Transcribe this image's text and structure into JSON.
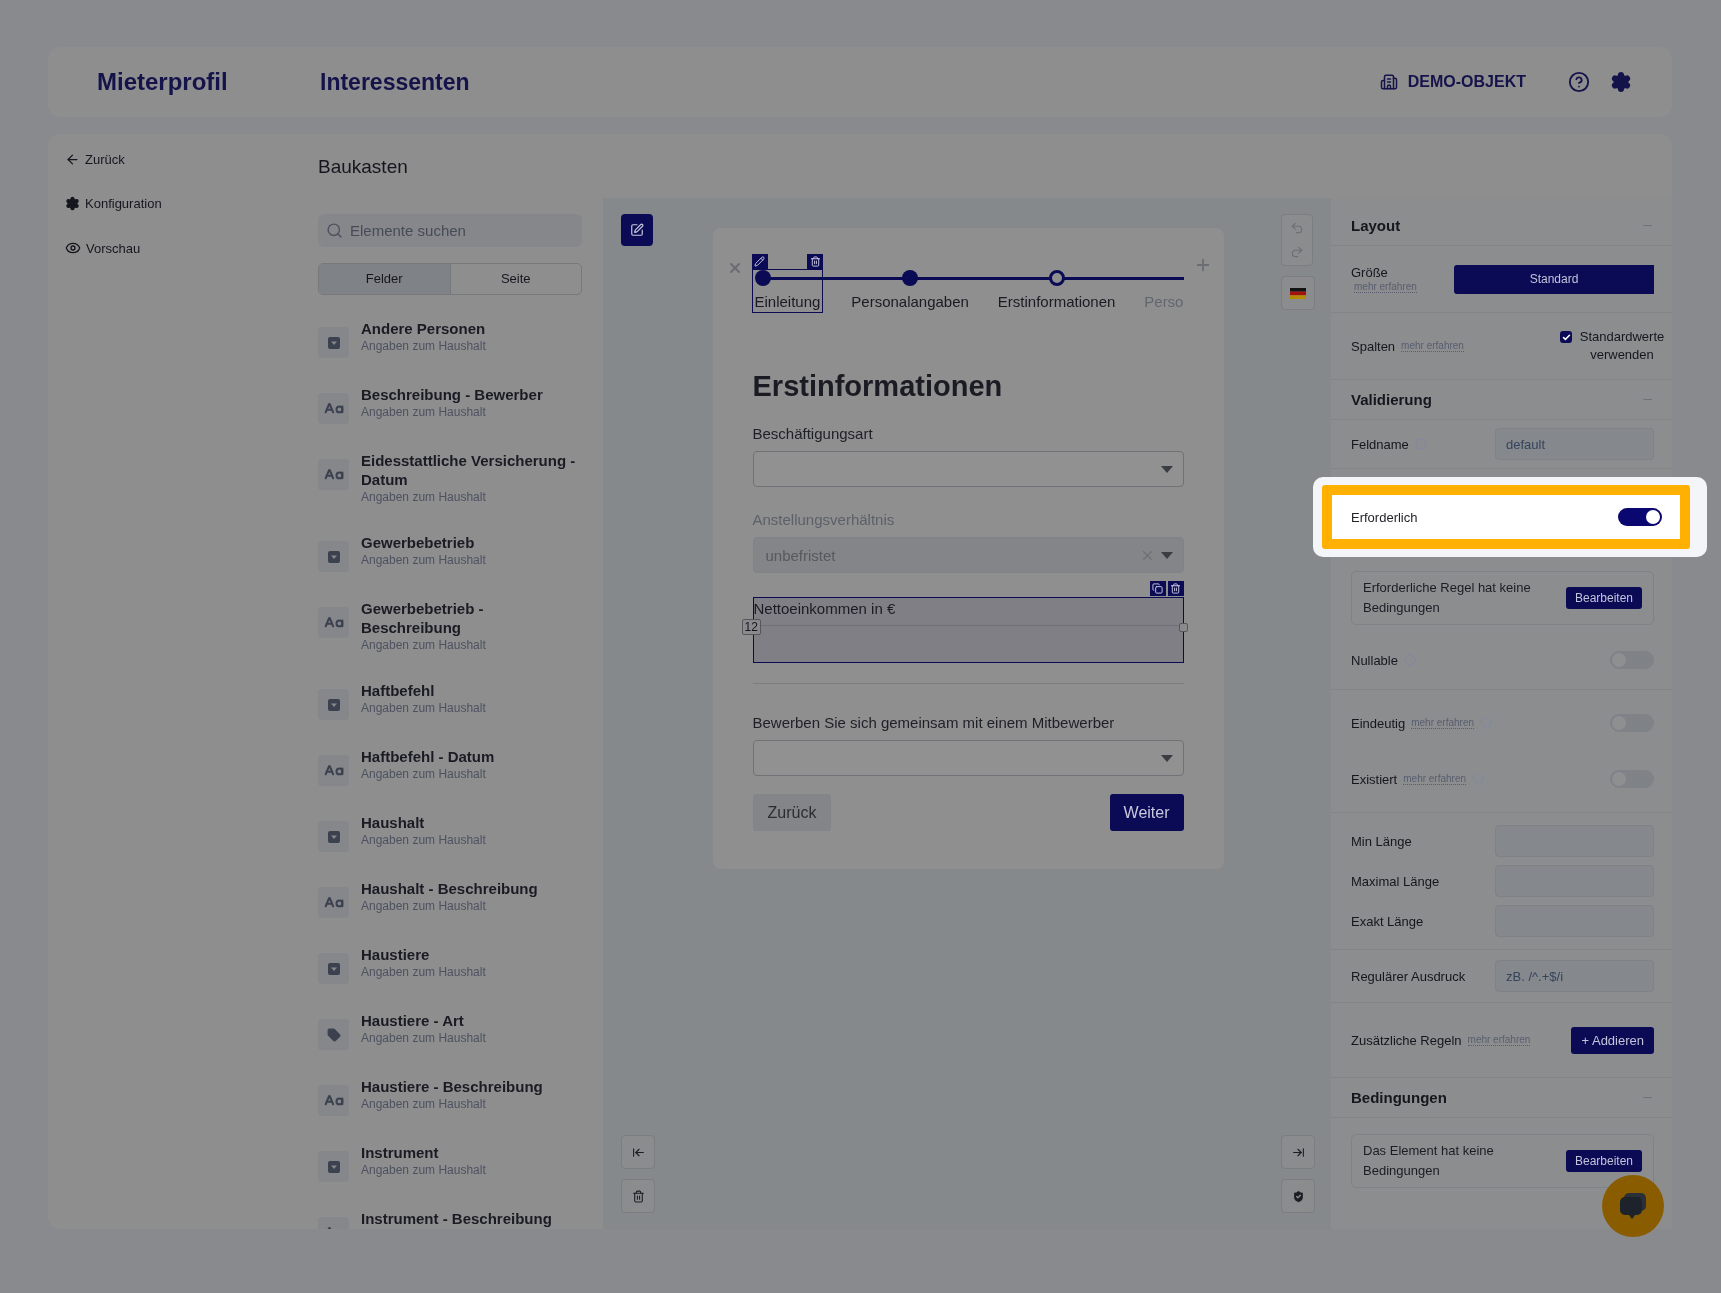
{
  "header": {
    "brand": "Mieterprofil",
    "section": "Interessenten",
    "object": "DEMO-OBJEKT"
  },
  "nav": [
    {
      "label": "Zurück",
      "kind": "back"
    },
    {
      "label": "Konfiguration",
      "kind": "settings"
    },
    {
      "label": "Vorschau",
      "kind": "preview"
    }
  ],
  "builder": {
    "title": "Baukasten",
    "search": {
      "placeholder": "Elemente suchen"
    },
    "tabs": [
      {
        "label": "Felder",
        "selected": true
      },
      {
        "label": "Seite",
        "selected": false
      }
    ],
    "items": [
      {
        "title": "Andere Personen",
        "subtitle": "Angaben zum Haushalt",
        "kind": "select"
      },
      {
        "title": "Beschreibung - Bewerber",
        "subtitle": "Angaben zum Haushalt",
        "kind": "text"
      },
      {
        "title": "Eidesstattliche Versicherung - Datum",
        "subtitle": "Angaben zum Haushalt",
        "kind": "text"
      },
      {
        "title": "Gewerbebetrieb",
        "subtitle": "Angaben zum Haushalt",
        "kind": "select"
      },
      {
        "title": "Gewerbebetrieb - Beschreibung",
        "subtitle": "Angaben zum Haushalt",
        "kind": "text"
      },
      {
        "title": "Haftbefehl",
        "subtitle": "Angaben zum Haushalt",
        "kind": "select"
      },
      {
        "title": "Haftbefehl - Datum",
        "subtitle": "Angaben zum Haushalt",
        "kind": "text"
      },
      {
        "title": "Haushalt",
        "subtitle": "Angaben zum Haushalt",
        "kind": "select"
      },
      {
        "title": "Haushalt - Beschreibung",
        "subtitle": "Angaben zum Haushalt",
        "kind": "text"
      },
      {
        "title": "Haustiere",
        "subtitle": "Angaben zum Haushalt",
        "kind": "select"
      },
      {
        "title": "Haustiere - Art",
        "subtitle": "Angaben zum Haushalt",
        "kind": "tag"
      },
      {
        "title": "Haustiere - Beschreibung",
        "subtitle": "Angaben zum Haushalt",
        "kind": "text"
      },
      {
        "title": "Instrument",
        "subtitle": "Angaben zum Haushalt",
        "kind": "select"
      },
      {
        "title": "Instrument - Beschreibung",
        "kind": "text"
      }
    ]
  },
  "canvas": {
    "steps": [
      {
        "label": "Einleitung",
        "completed": true,
        "selected": false,
        "editing": true
      },
      {
        "label": "Personalangaben",
        "completed": true,
        "selected": false,
        "editing": false
      },
      {
        "label": "Erstinformationen",
        "completed": false,
        "selected": true,
        "editing": false
      },
      {
        "label": "Perso",
        "completed": false,
        "selected": false,
        "editing": false
      }
    ],
    "form": {
      "heading": "Erstinformationen",
      "fields": [
        {
          "kind": "select",
          "label": "Beschäftigungsart",
          "disabled": false
        },
        {
          "kind": "select",
          "label": "Anstellungsverhältnis",
          "value": "unbefristet",
          "disabled": true
        },
        {
          "kind": "textarea",
          "label": "Nettoeinkommen in €",
          "badge": "12",
          "selected": true
        },
        {
          "kind": "divider"
        },
        {
          "kind": "select",
          "label": "Bewerben Sie sich gemeinsam mit einem Mitbewerber",
          "disabled": false
        }
      ],
      "back": "Zurück",
      "next": "Weiter"
    }
  },
  "panel": {
    "layout": {
      "title": "Layout",
      "size": {
        "label": "Größe",
        "link": "mehr erfahren",
        "value": "Standard"
      },
      "columns": {
        "label": "Spalten",
        "link": "mehr erfahren",
        "checkbox": {
          "label": "Standardwerte verwenden",
          "checked": true
        }
      }
    },
    "validation": {
      "title": "Validierung",
      "groups": [
        [
          {
            "kind": "input",
            "label": "Feldname",
            "info": true,
            "placeholder": "default"
          }
        ],
        [
          {
            "kind": "toggle",
            "label": "Erforderlich",
            "on": true,
            "highlighted": true
          },
          {
            "kind": "note",
            "text": "Erforderliche Regel hat keine Bedingungen",
            "button": "Bearbeiten"
          },
          {
            "kind": "toggle",
            "label": "Nullable",
            "info": true,
            "on": false,
            "highlighted": false
          }
        ],
        [
          {
            "kind": "toggle",
            "label": "Eindeutig",
            "link": "mehr erfahren",
            "info": true,
            "on": false,
            "highlighted": false
          },
          {
            "kind": "toggle",
            "label": "Existiert",
            "link": "mehr erfahren",
            "info": true,
            "on": false,
            "highlighted": false
          }
        ],
        [
          {
            "kind": "input",
            "label": "Min Länge"
          },
          {
            "kind": "input",
            "label": "Maximal Länge"
          },
          {
            "kind": "input",
            "label": "Exakt Länge"
          }
        ],
        [
          {
            "kind": "input",
            "label": "Regulärer Ausdruck",
            "placeholder": "zB. /^.+$/i"
          }
        ],
        [
          {
            "kind": "action",
            "label": "Zusätzliche Regeln",
            "link": "mehr erfahren",
            "button": "+ Addieren"
          }
        ]
      ]
    },
    "conditions": {
      "title": "Bedingungen",
      "note": "Das Element hat keine Bedingungen",
      "button": "Bearbeiten"
    }
  }
}
